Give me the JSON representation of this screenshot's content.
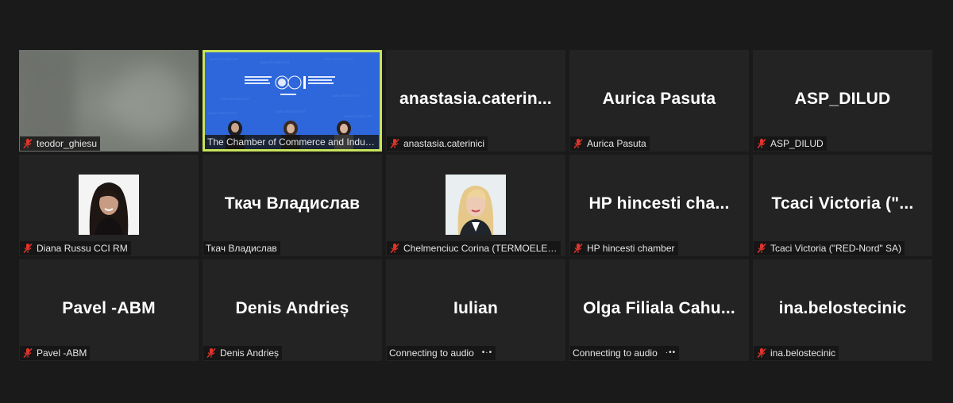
{
  "colors": {
    "background": "#1a1a1a",
    "tile": "#232323",
    "active_border": "#c8e35a",
    "mute": "#e0342b"
  },
  "participants": [
    {
      "big_name": "",
      "label": "teodor_ghiesu",
      "muted": true,
      "video": "blurred"
    },
    {
      "big_name": "",
      "label": "The Chamber of Commerce and Industr...",
      "muted": false,
      "video": "chamber",
      "active": true
    },
    {
      "big_name": "anastasia.caterin...",
      "label": "anastasia.caterinici",
      "muted": true
    },
    {
      "big_name": "Aurica Pasuta",
      "label": "Aurica Pasuta",
      "muted": true
    },
    {
      "big_name": "ASP_DILUD",
      "label": "ASP_DILUD",
      "muted": true
    },
    {
      "big_name": "",
      "label": "Diana Russu CCI RM",
      "muted": true,
      "video": "photo-woman-dark-hair"
    },
    {
      "big_name": "Ткач Владислав",
      "label": "Ткач Владислав",
      "muted": false
    },
    {
      "big_name": "",
      "label": "Chelmenciuc Corina (TERMOELECTRI...",
      "muted": true,
      "video": "photo-woman-blonde"
    },
    {
      "big_name": "HP hincesti cha...",
      "label": "HP hincesti chamber",
      "muted": true
    },
    {
      "big_name": "Tcaci Victoria (\"...",
      "label": "Tcaci Victoria (\"RED-Nord\" SA)",
      "muted": true
    },
    {
      "big_name": "Pavel -ABM",
      "label": "Pavel -ABM",
      "muted": true
    },
    {
      "big_name": "Denis Andrieș",
      "label": "Denis Andrieș",
      "muted": true
    },
    {
      "big_name": "Iulian",
      "label": "Connecting to audio",
      "muted": false,
      "connecting": true
    },
    {
      "big_name": "Olga Filiala Cahu...",
      "label": "Connecting to audio",
      "muted": false,
      "connecting": true
    },
    {
      "big_name": "ina.belostecinic",
      "label": "ina.belostecinic",
      "muted": true
    }
  ]
}
